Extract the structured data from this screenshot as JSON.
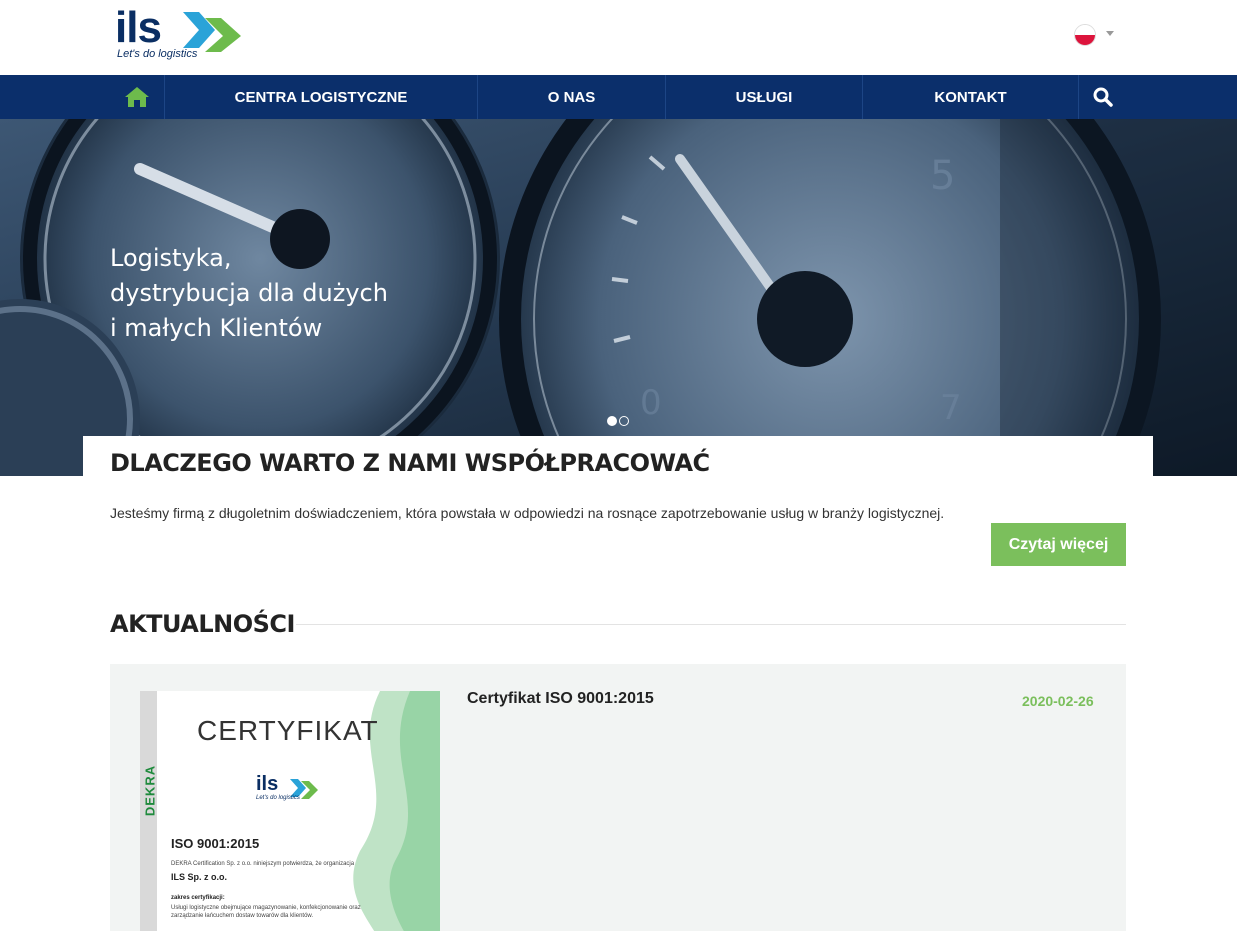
{
  "header": {
    "logo_text": "ils",
    "logo_tagline": "Let's do logistics",
    "language": "pl"
  },
  "nav": {
    "items": [
      {
        "label": "CENTRA LOGISTYCZNE"
      },
      {
        "label": "O NAS"
      },
      {
        "label": "USŁUGI"
      },
      {
        "label": "KONTAKT"
      }
    ]
  },
  "hero": {
    "lines": [
      "Logistyka,",
      "dystrybucja dla dużych",
      "i małych Klientów"
    ],
    "slides_total": 2,
    "active_slide": 1
  },
  "why": {
    "title": "DLACZEGO WARTO Z NAMI WSPÓŁPRACOWAĆ",
    "description": "Jesteśmy firmą z długoletnim doświadczeniem, która powstała w odpowiedzi na rosnące zapotrzebowanie usług w branży logistycznej.",
    "button_label": "Czytaj więcej"
  },
  "news": {
    "section_title": "AKTUALNOŚCI",
    "items": [
      {
        "title": "Certyfikat ISO 9001:2015",
        "date": "2020-02-26",
        "image": {
          "heading": "CERTYFIKAT",
          "brand": "DEKRA",
          "logo_text": "ils",
          "logo_tagline": "Let's do logistics",
          "standard": "ISO 9001:2015",
          "confirmation": "DEKRA Certification Sp. z o.o. niniejszym potwierdza, że organizacja",
          "organization": "ILS Sp. z o.o.",
          "scope_heading": "zakres certyfikacji:",
          "scope": "Usługi logistyczne obejmujące magazynowanie, konfekcjonowanie oraz zarządzanie łańcuchem dostaw towarów dla klientów."
        }
      }
    ]
  },
  "colors": {
    "nav_bg": "#0b2f6b",
    "accent_green": "#7bbf5c",
    "logo_blue": "#0a2e63"
  }
}
